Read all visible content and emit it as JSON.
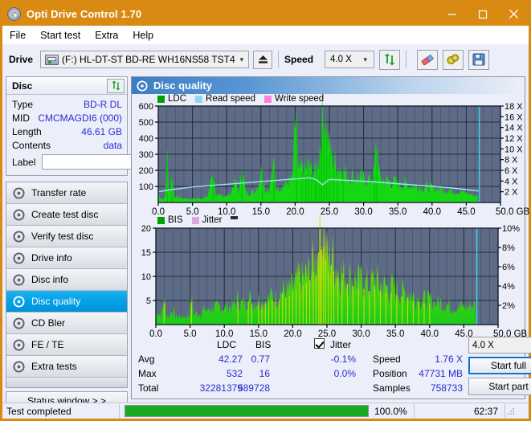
{
  "window": {
    "title": "Opti Drive Control 1.70",
    "accent": "#d98a12",
    "minimize_label": "–",
    "maximize_label": "□",
    "close_label": "✕"
  },
  "menu": {
    "items": [
      "File",
      "Start test",
      "Extra",
      "Help"
    ]
  },
  "toolbar": {
    "drive_label": "Drive",
    "drive_value": "(F:)  HL-DT-ST BD-RE  WH16NS58 TST4",
    "eject_title": "Eject",
    "speed_label": "Speed",
    "speed_value": "4.0 X",
    "refresh_icon": "refresh-icon",
    "erase_icon": "erase-icon",
    "settings_icon": "settings-icon",
    "save_icon": "save-icon"
  },
  "disc": {
    "header": "Disc",
    "refresh_icon": "refresh-icon",
    "rows": [
      {
        "key": "Type",
        "value": "BD-R DL"
      },
      {
        "key": "MID",
        "value": "CMCMAGDI6 (000)"
      },
      {
        "key": "Length",
        "value": "46.61 GB"
      },
      {
        "key": "Contents",
        "value": "data"
      }
    ],
    "label_key": "Label",
    "label_value": "",
    "label_placeholder": ""
  },
  "nav": {
    "items": [
      {
        "label": "Transfer rate",
        "selected": false
      },
      {
        "label": "Create test disc",
        "selected": false
      },
      {
        "label": "Verify test disc",
        "selected": false
      },
      {
        "label": "Drive info",
        "selected": false
      },
      {
        "label": "Disc info",
        "selected": false
      },
      {
        "label": "Disc quality",
        "selected": true
      },
      {
        "label": "CD Bler",
        "selected": false
      },
      {
        "label": "FE / TE",
        "selected": false
      },
      {
        "label": "Extra tests",
        "selected": false
      }
    ],
    "status_button": "Status window > >"
  },
  "panel": {
    "title": "Disc quality"
  },
  "stats": {
    "col_ldc": "LDC",
    "col_bis": "BIS",
    "jitter_label": "Jitter",
    "jitter_checked": true,
    "rows": [
      {
        "name": "Avg",
        "ldc": "42.27",
        "bis": "0.77",
        "jitter": "-0.1%"
      },
      {
        "name": "Max",
        "ldc": "532",
        "bis": "16",
        "jitter": "0.0%"
      },
      {
        "name": "Total",
        "ldc": "32281379",
        "bis": "589728",
        "jitter": ""
      }
    ],
    "speed_label": "Speed",
    "speed_value": "1.76 X",
    "position_label": "Position",
    "position_value": "47731 MB",
    "samples_label": "Samples",
    "samples_value": "758733",
    "speed_select": "4.0 X",
    "start_full": "Start full",
    "start_part": "Start part"
  },
  "statusbar": {
    "message": "Test completed",
    "progress_text": "100.0%",
    "progress_value": 100,
    "elapsed": "62:37"
  },
  "chart_data": [
    {
      "type": "area",
      "id": "ldc-chart",
      "title": "",
      "xlabel": "GB",
      "ylabel": "",
      "xlim": [
        0,
        50
      ],
      "ylim": [
        0,
        600
      ],
      "y2lim": [
        0,
        18
      ],
      "y2label": "X",
      "grid": true,
      "legend_position": "top-left",
      "legend": [
        {
          "name": "LDC",
          "color": "#00a000"
        },
        {
          "name": "Read speed",
          "color": "#8fd6f4"
        },
        {
          "name": "Write speed",
          "color": "#ff7fe0"
        }
      ],
      "xticks": [
        "0.0",
        "5.0",
        "10.0",
        "15.0",
        "20.0",
        "25.0",
        "30.0",
        "35.0",
        "40.0",
        "45.0",
        "50.0 GB"
      ],
      "yticks": [
        0,
        100,
        200,
        300,
        400,
        500,
        600
      ],
      "y2ticks": [
        "2 X",
        "4 X",
        "6 X",
        "8 X",
        "10 X",
        "12 X",
        "14 X",
        "16 X",
        "18 X"
      ],
      "plot_bg": "#5d6b87",
      "series": [
        {
          "name": "LDC",
          "color": "#00c000",
          "x": [
            0.0,
            0.5,
            1.0,
            1.3,
            1.6,
            2.0,
            2.4,
            3.0,
            3.6,
            4.2,
            5.0,
            5.8,
            6.5,
            7.2,
            8.0,
            8.4,
            9.0,
            9.8,
            10.5,
            11.2,
            11.8,
            12.2,
            12.8,
            13.4,
            14.0,
            14.6,
            15.2,
            15.6,
            16.2,
            16.9,
            17.2,
            17.8,
            18.4,
            19.0,
            19.6,
            20.2,
            20.4,
            21.0,
            21.6,
            22.0,
            22.4,
            22.9,
            23.2,
            23.6,
            23.9,
            24.2,
            24.6,
            25.0,
            25.6,
            26.2,
            27.0,
            27.8,
            28.6,
            29.4,
            30.2,
            31.0,
            31.6,
            31.9,
            32.4,
            33.0,
            33.8,
            34.6,
            35.4,
            36.2,
            37.0,
            37.8,
            38.6,
            39.4,
            40.2,
            41.0,
            41.8,
            42.6,
            43.4,
            44.2,
            45.0,
            45.6,
            46.2,
            46.6,
            46.8
          ],
          "values": [
            55,
            18,
            22,
            260,
            45,
            155,
            30,
            26,
            24,
            22,
            20,
            22,
            26,
            30,
            180,
            36,
            34,
            38,
            42,
            120,
            50,
            195,
            52,
            56,
            60,
            100,
            200,
            70,
            75,
            205,
            80,
            88,
            95,
            110,
            125,
            515,
            150,
            190,
            175,
            205,
            170,
            160,
            200,
            300,
            430,
            487,
            400,
            300,
            230,
            200,
            175,
            150,
            140,
            135,
            130,
            125,
            165,
            340,
            130,
            120,
            118,
            112,
            105,
            100,
            96,
            92,
            88,
            84,
            80,
            76,
            72,
            68,
            64,
            60,
            52,
            46,
            40,
            36,
            4
          ]
        },
        {
          "name": "Read speed",
          "color": "#9fe0f8",
          "x": [
            0.0,
            2.0,
            5.0,
            8.0,
            11.0,
            14.0,
            17.0,
            20.0,
            22.0,
            23.0,
            24.0,
            25.0,
            28.0,
            31.0,
            34.0,
            37.0,
            40.0,
            43.0,
            45.0,
            46.5,
            46.8
          ],
          "values": [
            2.0,
            2.4,
            2.9,
            3.2,
            3.5,
            3.8,
            4.1,
            4.4,
            4.6,
            4.3,
            3.3,
            4.3,
            4.1,
            3.9,
            3.6,
            3.3,
            3.0,
            2.7,
            2.4,
            2.2,
            2.1
          ]
        }
      ],
      "cursor_x": 46.9,
      "cursor_color": "#39d6f5"
    },
    {
      "type": "area",
      "id": "bis-jitter-chart",
      "title": "",
      "xlabel": "GB",
      "ylabel": "",
      "xlim": [
        0,
        50
      ],
      "ylim": [
        0,
        20
      ],
      "y2lim": [
        0,
        10
      ],
      "y2label": "%",
      "grid": true,
      "legend_position": "top-left",
      "legend": [
        {
          "name": "BIS",
          "color": "#00a000"
        },
        {
          "name": "Jitter",
          "color": "#d9a8e0"
        }
      ],
      "xticks": [
        "0.0",
        "5.0",
        "10.0",
        "15.0",
        "20.0",
        "25.0",
        "30.0",
        "35.0",
        "40.0",
        "45.0",
        "50.0 GB"
      ],
      "yticks": [
        0,
        5,
        10,
        15,
        20
      ],
      "y2ticks": [
        "2%",
        "4%",
        "6%",
        "8%",
        "10%"
      ],
      "plot_bg": "#5d6b87",
      "series": [
        {
          "name": "BIS",
          "color": "#2ad62a",
          "x": [
            0.0,
            0.4,
            0.8,
            1.2,
            1.6,
            2.0,
            2.4,
            2.8,
            3.2,
            3.6,
            4.0,
            4.4,
            4.8,
            5.2,
            5.6,
            6.0,
            6.4,
            6.8,
            7.2,
            7.6,
            8.0,
            8.5,
            9.0,
            9.5,
            10.0,
            10.5,
            11.0,
            11.5,
            12.0,
            12.5,
            13.0,
            13.5,
            14.0,
            14.5,
            15.0,
            15.5,
            16.0,
            16.5,
            17.0,
            17.5,
            18.0,
            18.5,
            19.0,
            19.5,
            20.0,
            20.5,
            21.0,
            21.5,
            22.0,
            22.5,
            23.0,
            23.4,
            23.8,
            24.0,
            24.2,
            24.5,
            24.8,
            25.2,
            25.6,
            26.0,
            26.6,
            27.2,
            28.0,
            28.8,
            29.6,
            30.4,
            31.2,
            32.0,
            32.8,
            33.6,
            34.4,
            35.2,
            36.0,
            36.8,
            37.6,
            38.4,
            39.2,
            40.0,
            40.8,
            41.6,
            42.4,
            43.2,
            44.0,
            44.8,
            45.6,
            46.2,
            46.6,
            46.8
          ],
          "values": [
            2.5,
            2.0,
            1.5,
            4.5,
            1.6,
            1.4,
            3.0,
            1.5,
            1.4,
            1.5,
            1.4,
            1.5,
            1.5,
            4.6,
            1.7,
            2.0,
            2.0,
            2.2,
            2.8,
            2.4,
            3.0,
            2.8,
            3.0,
            3.1,
            3.0,
            3.2,
            3.3,
            3.4,
            4.5,
            3.6,
            3.7,
            4.8,
            4.2,
            4.0,
            4.5,
            4.2,
            4.4,
            4.6,
            5.2,
            4.8,
            5.2,
            6.3,
            5.6,
            6.0,
            6.6,
            7.2,
            8.5,
            8.0,
            8.6,
            9.2,
            11.0,
            10.2,
            15.0,
            16.2,
            15.5,
            16.2,
            13.5,
            11.0,
            12.3,
            11.0,
            9.8,
            9.0,
            8.4,
            8.0,
            7.6,
            7.4,
            7.0,
            8.0,
            7.0,
            6.6,
            6.6,
            6.2,
            5.8,
            5.6,
            5.0,
            4.8,
            4.4,
            4.2,
            4.0,
            3.8,
            3.6,
            3.2,
            3.0,
            3.2,
            3.0,
            3.6,
            3.4,
            0.8
          ]
        }
      ],
      "cursor_x": 46.9,
      "cursor_color": "#39d6f5"
    }
  ]
}
